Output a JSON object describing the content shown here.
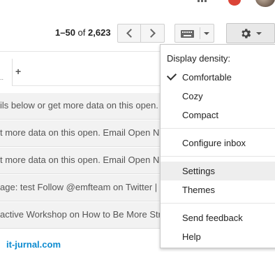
{
  "pager": {
    "range": "1–50",
    "of_word": "of",
    "total": "2,623"
  },
  "tabs": {
    "overflow": "..",
    "add": "+"
  },
  "rows": [
    "ils below or get more data on this open.",
    "t more data on this open. Email Open N",
    "t more data on this open. Email Open N",
    "age: test Follow @emfteam on Twitter |",
    "active Workshop on How to Be More Stra"
  ],
  "watermark": "it-jurnal.com",
  "menu": {
    "density_heading": "Display density:",
    "comfortable": "Comfortable",
    "cozy": "Cozy",
    "compact": "Compact",
    "configure_inbox": "Configure inbox",
    "settings": "Settings",
    "themes": "Themes",
    "send_feedback": "Send feedback",
    "help": "Help"
  },
  "icons": {
    "apps": "apps-grid-icon",
    "notifications": "notifications-icon",
    "prev": "chevron-left-icon",
    "next": "chevron-right-icon",
    "keyboard": "keyboard-icon",
    "settings": "gear-icon",
    "check": "checkmark-icon"
  },
  "colors": {
    "notification": "#db4437",
    "watermark": "#0d8bd0",
    "highlight": "#eeeeee"
  }
}
